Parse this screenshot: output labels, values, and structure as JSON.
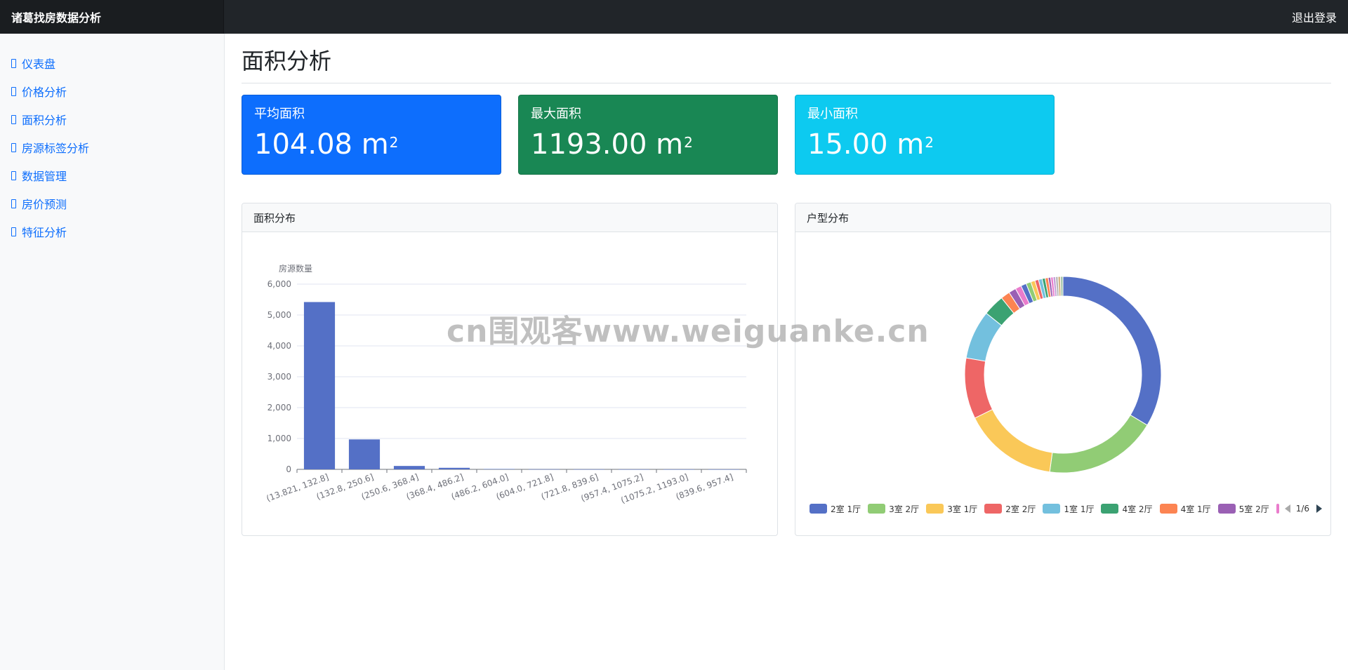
{
  "app": {
    "title": "诸葛找房数据分析",
    "logout_label": "退出登录"
  },
  "sidebar": {
    "items": [
      {
        "label": "仪表盘"
      },
      {
        "label": "价格分析"
      },
      {
        "label": "面积分析"
      },
      {
        "label": "房源标签分析"
      },
      {
        "label": "数据管理"
      },
      {
        "label": "房价预测"
      },
      {
        "label": "特征分析"
      }
    ]
  },
  "page": {
    "title": "面积分析"
  },
  "stats": {
    "avg": {
      "label": "平均面积",
      "value": "104.08",
      "unit": "m",
      "sup": "2",
      "color": "#0d6efd"
    },
    "max": {
      "label": "最大面积",
      "value": "1193.00",
      "unit": "m",
      "sup": "2",
      "color": "#198754"
    },
    "min": {
      "label": "最小面积",
      "value": "15.00",
      "unit": "m",
      "sup": "2",
      "color": "#0dcaf0"
    }
  },
  "area_card": {
    "title": "面积分布"
  },
  "layout_card": {
    "title": "户型分布"
  },
  "watermark": "cn围观客www.weiguanke.cn",
  "chart_data": [
    {
      "type": "bar",
      "ylabel": "房源数量",
      "ylim": [
        0,
        6000
      ],
      "yticks": [
        "0",
        "1,000",
        "2,000",
        "3,000",
        "4,000",
        "5,000",
        "6,000"
      ],
      "categories": [
        "(13.821, 132.8]",
        "(132.8, 250.6]",
        "(250.6, 368.4]",
        "(368.4, 486.2]",
        "(486.2, 604.0]",
        "(604.0, 721.8]",
        "(721.8, 839.6]",
        "(957.4, 1075.2]",
        "(1075.2, 1193.0]",
        "(839.6, 957.4]"
      ],
      "values": [
        5420,
        970,
        110,
        50,
        12,
        5,
        3,
        2,
        1,
        1
      ],
      "color": "#5470c6",
      "grid": true
    },
    {
      "type": "pie",
      "donut": true,
      "legend_position": "bottom",
      "legend_page": "1/6",
      "slices": [
        {
          "name": "2室 1厅",
          "value": 33.5,
          "color": "#5470c6"
        },
        {
          "name": "3室 2厅",
          "value": 18.5,
          "color": "#91cc75"
        },
        {
          "name": "3室 1厅",
          "value": 15.5,
          "color": "#fac858"
        },
        {
          "name": "2室 2厅",
          "value": 10.0,
          "color": "#ee6666"
        },
        {
          "name": "1室 1厅",
          "value": 8.0,
          "color": "#73c0de"
        },
        {
          "name": "4室 2厅",
          "value": 3.5,
          "color": "#3ba272"
        },
        {
          "name": "4室 1厅",
          "value": 1.5,
          "color": "#fc8452"
        },
        {
          "name": "5室 2厅",
          "value": 1.2,
          "color": "#9a60b4"
        },
        {
          "name": "",
          "value": 1.0,
          "color": "#ea7ccc"
        },
        {
          "name": "",
          "value": 0.9,
          "color": "#5470c6"
        },
        {
          "name": "",
          "value": 0.8,
          "color": "#91cc75"
        },
        {
          "name": "",
          "value": 0.7,
          "color": "#fac858"
        },
        {
          "name": "",
          "value": 0.6,
          "color": "#ee6666"
        },
        {
          "name": "",
          "value": 0.6,
          "color": "#73c0de"
        },
        {
          "name": "",
          "value": 0.5,
          "color": "#3ba272"
        },
        {
          "name": "",
          "value": 0.5,
          "color": "#fc8452"
        },
        {
          "name": "",
          "value": 0.4,
          "color": "#9a60b4"
        },
        {
          "name": "",
          "value": 0.4,
          "color": "#ea7ccc"
        },
        {
          "name": "",
          "value": 0.4,
          "color": "#c4a0d9"
        },
        {
          "name": "",
          "value": 0.4,
          "color": "#b8b8b8"
        },
        {
          "name": "",
          "value": 0.4,
          "color": "#d4b483"
        },
        {
          "name": "",
          "value": 0.4,
          "color": "#a3c4a8"
        }
      ]
    }
  ]
}
